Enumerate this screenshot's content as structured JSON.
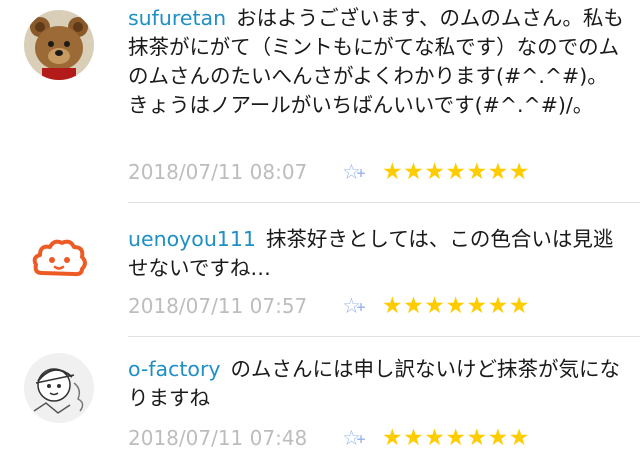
{
  "comments": [
    {
      "username": "sufuretan",
      "text": "おはようございます、のムのムさん。私も抹茶がにがて（ミントもにがてな私です）なのでのムのムさんのたいへんさがよくわかります(#^.^#)。きょうはノアールがいちばんいいです(#^.^#)/。",
      "timestamp": "2018/07/11 08:07",
      "stars": "★★★★★★★",
      "avatar": "teddy-bear-avatar"
    },
    {
      "username": "uenoyou111",
      "text": "抹茶好きとしては、この色合いは見逃せないですね…",
      "timestamp": "2018/07/11 07:57",
      "stars": "★★★★★★★",
      "avatar": "cloud-face-avatar"
    },
    {
      "username": "o-factory",
      "text": "のムさんには申し訳ないけど抹茶が気になりますね",
      "timestamp": "2018/07/11 07:48",
      "stars": "★★★★★★★",
      "avatar": "sketch-character-avatar"
    }
  ],
  "icons": {
    "add_star": "star-plus-icon"
  },
  "colors": {
    "username": "#1f8fc4",
    "star": "#ffcc00",
    "add_star": "#9ab6ee",
    "timestamp": "#bdbdbd"
  }
}
